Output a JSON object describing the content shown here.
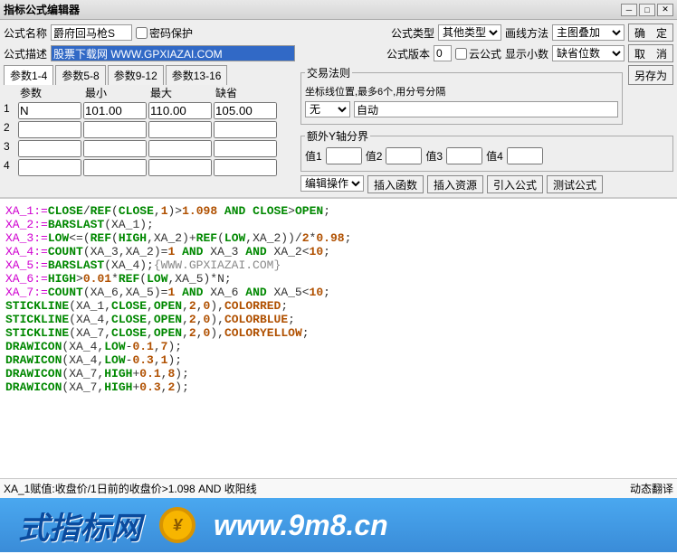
{
  "window": {
    "title": "指标公式编辑器"
  },
  "form": {
    "name_lbl": "公式名称",
    "name_val": "爵府回马枪S",
    "pwd_lbl": "密码保护",
    "type_lbl": "公式类型",
    "type_val": "其他类型",
    "draw_lbl": "画线方法",
    "draw_val": "主图叠加",
    "ok": "确　定",
    "desc_lbl": "公式描述",
    "desc_val": "股票下载网 WWW.GPXIAZAI.COM",
    "ver_lbl": "公式版本",
    "ver_val": "0",
    "cloud_lbl": "云公式",
    "dec_lbl": "显示小数",
    "dec_val": "缺省位数",
    "cancel": "取　消",
    "saveas": "另存为"
  },
  "tabs": [
    "参数1-4",
    "参数5-8",
    "参数9-12",
    "参数13-16"
  ],
  "paramhdr": [
    "参数",
    "最小",
    "最大",
    "缺省"
  ],
  "params": [
    {
      "n": "1",
      "name": "N",
      "min": "",
      "max": "101.00",
      "def_min": "110.00",
      "def": "105.00"
    },
    {
      "n": "2",
      "name": "",
      "min": "",
      "max": "",
      "def_min": "",
      "def": ""
    },
    {
      "n": "3",
      "name": "",
      "min": "",
      "max": "",
      "def_min": "",
      "def": ""
    },
    {
      "n": "4",
      "name": "",
      "min": "",
      "max": "",
      "def_min": "",
      "def": ""
    }
  ],
  "rule": {
    "lbl": "交易法则",
    "hint": "坐标线位置,最多6个,用分号分隔",
    "sel": "无",
    "input": "自动"
  },
  "yaxis": {
    "lbl": "额外Y轴分界",
    "v1": "值1",
    "v2": "值2",
    "v3": "值3",
    "v4": "值4"
  },
  "btns": {
    "edit": "编辑操作",
    "insfn": "插入函数",
    "insres": "插入资源",
    "import": "引入公式",
    "test": "测试公式"
  },
  "code": [
    {
      "t": "XA_1:=",
      "c": "var"
    },
    {
      "t": "CLOSE",
      "c": "kw"
    },
    {
      "t": "/",
      "c": "op"
    },
    {
      "t": "REF",
      "c": "fn"
    },
    {
      "t": "(",
      "c": "op"
    },
    {
      "t": "CLOSE",
      "c": "kw"
    },
    {
      "t": ",",
      "c": "op"
    },
    {
      "t": "1",
      "c": "num"
    },
    {
      "t": ")>",
      "c": "op"
    },
    {
      "t": "1.098",
      "c": "num"
    },
    {
      "t": " AND ",
      "c": "kw"
    },
    {
      "t": "CLOSE",
      "c": "kw"
    },
    {
      "t": ">",
      "c": "op"
    },
    {
      "t": "OPEN",
      "c": "kw"
    },
    {
      "t": ";",
      "c": "op"
    },
    {
      "t": "\n"
    },
    {
      "t": "XA_2:=",
      "c": "var"
    },
    {
      "t": "BARSLAST",
      "c": "fn"
    },
    {
      "t": "(XA_1);",
      "c": "op"
    },
    {
      "t": "\n"
    },
    {
      "t": "XA_3:=",
      "c": "var"
    },
    {
      "t": "LOW",
      "c": "kw"
    },
    {
      "t": "<=(",
      "c": "op"
    },
    {
      "t": "REF",
      "c": "fn"
    },
    {
      "t": "(",
      "c": "op"
    },
    {
      "t": "HIGH",
      "c": "kw"
    },
    {
      "t": ",XA_2)+",
      "c": "op"
    },
    {
      "t": "REF",
      "c": "fn"
    },
    {
      "t": "(",
      "c": "op"
    },
    {
      "t": "LOW",
      "c": "kw"
    },
    {
      "t": ",XA_2))/",
      "c": "op"
    },
    {
      "t": "2",
      "c": "num"
    },
    {
      "t": "*",
      "c": "op"
    },
    {
      "t": "0.98",
      "c": "num"
    },
    {
      "t": ";",
      "c": "op"
    },
    {
      "t": "\n"
    },
    {
      "t": "XA_4:=",
      "c": "var"
    },
    {
      "t": "COUNT",
      "c": "fn"
    },
    {
      "t": "(XA_3,XA_2)=",
      "c": "op"
    },
    {
      "t": "1",
      "c": "num"
    },
    {
      "t": " AND ",
      "c": "kw"
    },
    {
      "t": "XA_3 ",
      "c": "op"
    },
    {
      "t": "AND ",
      "c": "kw"
    },
    {
      "t": "XA_2<",
      "c": "op"
    },
    {
      "t": "10",
      "c": "num"
    },
    {
      "t": ";",
      "c": "op"
    },
    {
      "t": "\n"
    },
    {
      "t": "XA_5:=",
      "c": "var"
    },
    {
      "t": "BARSLAST",
      "c": "fn"
    },
    {
      "t": "(XA_4);",
      "c": "op"
    },
    {
      "t": "{WWW.GPXIAZAI.COM}",
      "c": "cm"
    },
    {
      "t": "\n"
    },
    {
      "t": "XA_6:=",
      "c": "var"
    },
    {
      "t": "HIGH",
      "c": "kw"
    },
    {
      "t": ">",
      "c": "op"
    },
    {
      "t": "0.01",
      "c": "num"
    },
    {
      "t": "*",
      "c": "op"
    },
    {
      "t": "REF",
      "c": "fn"
    },
    {
      "t": "(",
      "c": "op"
    },
    {
      "t": "LOW",
      "c": "kw"
    },
    {
      "t": ",XA_5)*N;",
      "c": "op"
    },
    {
      "t": "\n"
    },
    {
      "t": "XA_7:=",
      "c": "var"
    },
    {
      "t": "COUNT",
      "c": "fn"
    },
    {
      "t": "(XA_6,XA_5)=",
      "c": "op"
    },
    {
      "t": "1",
      "c": "num"
    },
    {
      "t": " AND ",
      "c": "kw"
    },
    {
      "t": "XA_6 ",
      "c": "op"
    },
    {
      "t": "AND ",
      "c": "kw"
    },
    {
      "t": "XA_5<",
      "c": "op"
    },
    {
      "t": "10",
      "c": "num"
    },
    {
      "t": ";",
      "c": "op"
    },
    {
      "t": "\n"
    },
    {
      "t": "STICKLINE",
      "c": "fn"
    },
    {
      "t": "(XA_1,",
      "c": "op"
    },
    {
      "t": "CLOSE",
      "c": "kw"
    },
    {
      "t": ",",
      "c": "op"
    },
    {
      "t": "OPEN",
      "c": "kw"
    },
    {
      "t": ",",
      "c": "op"
    },
    {
      "t": "2",
      "c": "num"
    },
    {
      "t": ",",
      "c": "op"
    },
    {
      "t": "0",
      "c": "num"
    },
    {
      "t": "),",
      "c": "op"
    },
    {
      "t": "COLORRED",
      "c": "col"
    },
    {
      "t": ";",
      "c": "op"
    },
    {
      "t": "\n"
    },
    {
      "t": "STICKLINE",
      "c": "fn"
    },
    {
      "t": "(XA_4,",
      "c": "op"
    },
    {
      "t": "CLOSE",
      "c": "kw"
    },
    {
      "t": ",",
      "c": "op"
    },
    {
      "t": "OPEN",
      "c": "kw"
    },
    {
      "t": ",",
      "c": "op"
    },
    {
      "t": "2",
      "c": "num"
    },
    {
      "t": ",",
      "c": "op"
    },
    {
      "t": "0",
      "c": "num"
    },
    {
      "t": "),",
      "c": "op"
    },
    {
      "t": "COLORBLUE",
      "c": "col"
    },
    {
      "t": ";",
      "c": "op"
    },
    {
      "t": "\n"
    },
    {
      "t": "STICKLINE",
      "c": "fn"
    },
    {
      "t": "(XA_7,",
      "c": "op"
    },
    {
      "t": "CLOSE",
      "c": "kw"
    },
    {
      "t": ",",
      "c": "op"
    },
    {
      "t": "OPEN",
      "c": "kw"
    },
    {
      "t": ",",
      "c": "op"
    },
    {
      "t": "2",
      "c": "num"
    },
    {
      "t": ",",
      "c": "op"
    },
    {
      "t": "0",
      "c": "num"
    },
    {
      "t": "),",
      "c": "op"
    },
    {
      "t": "COLORYELLOW",
      "c": "col"
    },
    {
      "t": ";",
      "c": "op"
    },
    {
      "t": "\n"
    },
    {
      "t": "DRAWICON",
      "c": "fn"
    },
    {
      "t": "(XA_4,",
      "c": "op"
    },
    {
      "t": "LOW",
      "c": "kw"
    },
    {
      "t": "-",
      "c": "op"
    },
    {
      "t": "0.1",
      "c": "num"
    },
    {
      "t": ",",
      "c": "op"
    },
    {
      "t": "7",
      "c": "num"
    },
    {
      "t": ");",
      "c": "op"
    },
    {
      "t": "\n"
    },
    {
      "t": "DRAWICON",
      "c": "fn"
    },
    {
      "t": "(XA_4,",
      "c": "op"
    },
    {
      "t": "LOW",
      "c": "kw"
    },
    {
      "t": "-",
      "c": "op"
    },
    {
      "t": "0.3",
      "c": "num"
    },
    {
      "t": ",",
      "c": "op"
    },
    {
      "t": "1",
      "c": "num"
    },
    {
      "t": ");",
      "c": "op"
    },
    {
      "t": "\n"
    },
    {
      "t": "DRAWICON",
      "c": "fn"
    },
    {
      "t": "(XA_7,",
      "c": "op"
    },
    {
      "t": "HIGH",
      "c": "kw"
    },
    {
      "t": "+",
      "c": "op"
    },
    {
      "t": "0.1",
      "c": "num"
    },
    {
      "t": ",",
      "c": "op"
    },
    {
      "t": "8",
      "c": "num"
    },
    {
      "t": ");",
      "c": "op"
    },
    {
      "t": "\n"
    },
    {
      "t": "DRAWICON",
      "c": "fn"
    },
    {
      "t": "(XA_7,",
      "c": "op"
    },
    {
      "t": "HIGH",
      "c": "kw"
    },
    {
      "t": "+",
      "c": "op"
    },
    {
      "t": "0.3",
      "c": "num"
    },
    {
      "t": ",",
      "c": "op"
    },
    {
      "t": "2",
      "c": "num"
    },
    {
      "t": ");",
      "c": "op"
    }
  ],
  "status": {
    "left": "XA_1赋值:收盘价/1日前的收盘价>1.098 AND 收阳线",
    "right": "动态翻译"
  },
  "banner": {
    "t1": "式指标网",
    "t2": "www.9m8.cn"
  }
}
